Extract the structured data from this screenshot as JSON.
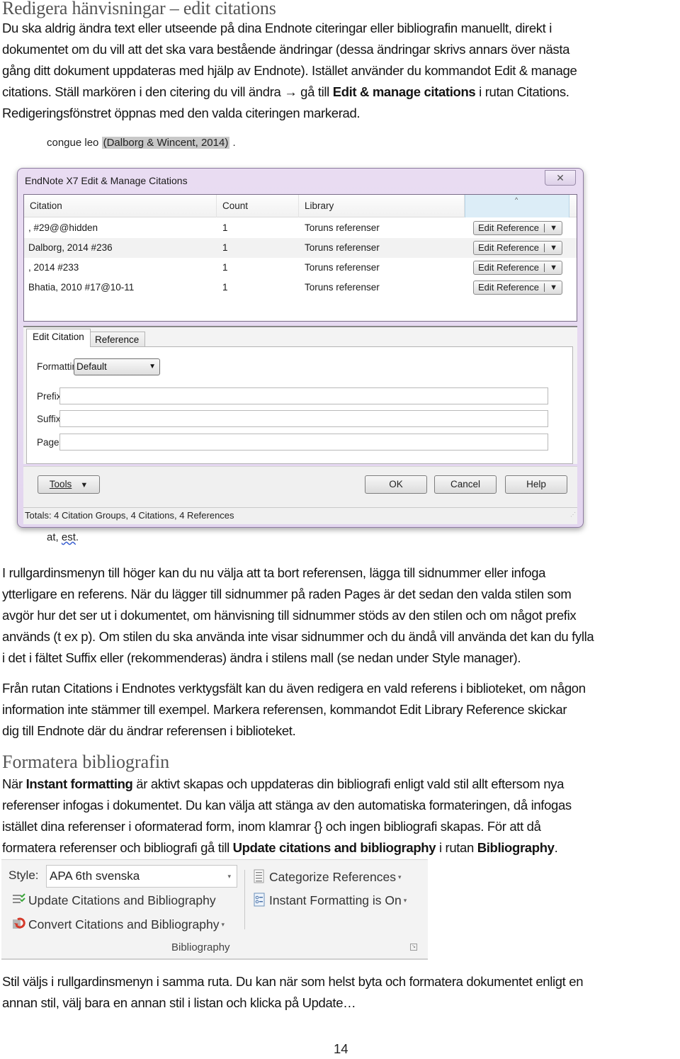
{
  "section1": {
    "heading": "Redigera hänvisningar – edit citations",
    "paragraph_lines": [
      "Du ska aldrig ändra text eller utseende på dina Endnote citeringar eller bibliografin manuellt, direkt i",
      "dokumentet om du vill att det ska vara bestående ändringar (dessa ändringar skrivs annars över nästa",
      "gång ditt dokument uppdateras med hjälp av Endnote). Istället använder du kommandot Edit & manage"
    ],
    "line4_pre": "citations. Ställ markören i den citering du vill ändra → gå till ",
    "line4_bold": "Edit & manage citations",
    "line4_post": " i rutan Citations.",
    "line5": "Redigeringsfönstret öppnas med den valda citeringen markerad."
  },
  "screenshot_edit": {
    "doc_text_before": "congue leo ",
    "doc_citation_highlight": "(Dalborg & Wincent, 2014)",
    "doc_text_after": " .",
    "doc_bottom_text_pre": "at, ",
    "doc_bottom_text_squiggle": "est",
    "doc_bottom_text_post": ".",
    "dialog": {
      "title": "EndNote X7 Edit & Manage Citations",
      "close_icon": "close-icon",
      "close_glyph": "✕",
      "columns": [
        "Citation",
        "Count",
        "Library"
      ],
      "sort_glyph": "^",
      "rows": [
        {
          "citation": ",  #29@@hidden",
          "count": "1",
          "library": "Toruns referenser",
          "action": "Edit Reference"
        },
        {
          "citation": "Dalborg, 2014 #236",
          "count": "1",
          "library": "Toruns referenser",
          "action": "Edit Reference"
        },
        {
          "citation": ", 2014 #233",
          "count": "1",
          "library": "Toruns referenser",
          "action": "Edit Reference"
        },
        {
          "citation": "Bhatia, 2010 #17@10-11",
          "count": "1",
          "library": "Toruns referenser",
          "action": "Edit Reference"
        }
      ],
      "action_caret": "▼",
      "tabs": [
        "Edit Citation",
        "Reference"
      ],
      "active_tab": "Edit Citation",
      "formatting_label": "Formatting:",
      "formatting_value": "Default",
      "prefix_label": "Prefix:",
      "prefix_value": "",
      "suffix_label": "Suffix:",
      "suffix_value": "",
      "pages_label": "Pages:",
      "pages_value": "",
      "tools_label": "Tools",
      "ok_label": "OK",
      "cancel_label": "Cancel",
      "help_label": "Help",
      "status": "Totals: 4 Citation Groups, 4 Citations, 4 References"
    }
  },
  "section1_para2_lines": [
    "I rullgardinsmenyn till höger kan du nu välja att ta bort referensen, lägga till sidnummer eller infoga",
    "ytterligare en referens. När du lägger till sidnummer på raden Pages är det sedan den valda stilen som",
    "avgör hur det ser ut i dokumentet, om hänvisning till sidnummer stöds av den stilen och om något prefix",
    "används (t ex p). Om stilen du ska använda inte visar sidnummer och du ändå vill använda det kan du fylla",
    "i det i fältet Suffix eller (rekommenderas) ändra i stilens mall (se nedan under Style manager)."
  ],
  "section1_para3_lines": [
    "Från rutan Citations i Endnotes verktygsfält kan du även redigera en vald referens i biblioteket, om någon",
    "information inte stämmer till exempel. Markera referensen, kommandot Edit Library Reference skickar",
    "dig till Endnote där du ändrar referensen i biblioteket."
  ],
  "section2": {
    "heading": "Formatera bibliografin",
    "l1_pre": "När ",
    "l1_bold": "Instant formatting",
    "l1_post": " är aktivt skapas och uppdateras din bibliografi enligt vald stil allt eftersom nya",
    "l2": "referenser infogas i dokumentet. Du kan välja att stänga av den automatiska formateringen, då infogas",
    "l3": "istället dina referenser i oformaterad form, inom klamrar {} och ingen bibliografi skapas. För att då",
    "l4_pre": "formatera referenser och bibliografi gå till ",
    "l4_bold1": "Update citations and bibliography",
    "l4_mid": " i rutan ",
    "l4_bold2": "Bibliography",
    "l4_post": "."
  },
  "ribbon": {
    "style_label": "Style:",
    "style_value": "APA 6th svenska",
    "update_label": "Update Citations and Bibliography",
    "convert_label": "Convert Citations and Bibliography",
    "categorize_label": "Categorize References",
    "instant_label": "Instant Formatting is On",
    "group_label": "Bibliography",
    "dropdown_glyph": "▾"
  },
  "section2_para2_lines": [
    "Stil väljs i rullgardinsmenyn i samma ruta. Du kan när som helst byta och formatera dokumentet enligt en",
    "annan stil, välj bara en annan stil i listan och klicka på Update…"
  ],
  "page_number": "14"
}
